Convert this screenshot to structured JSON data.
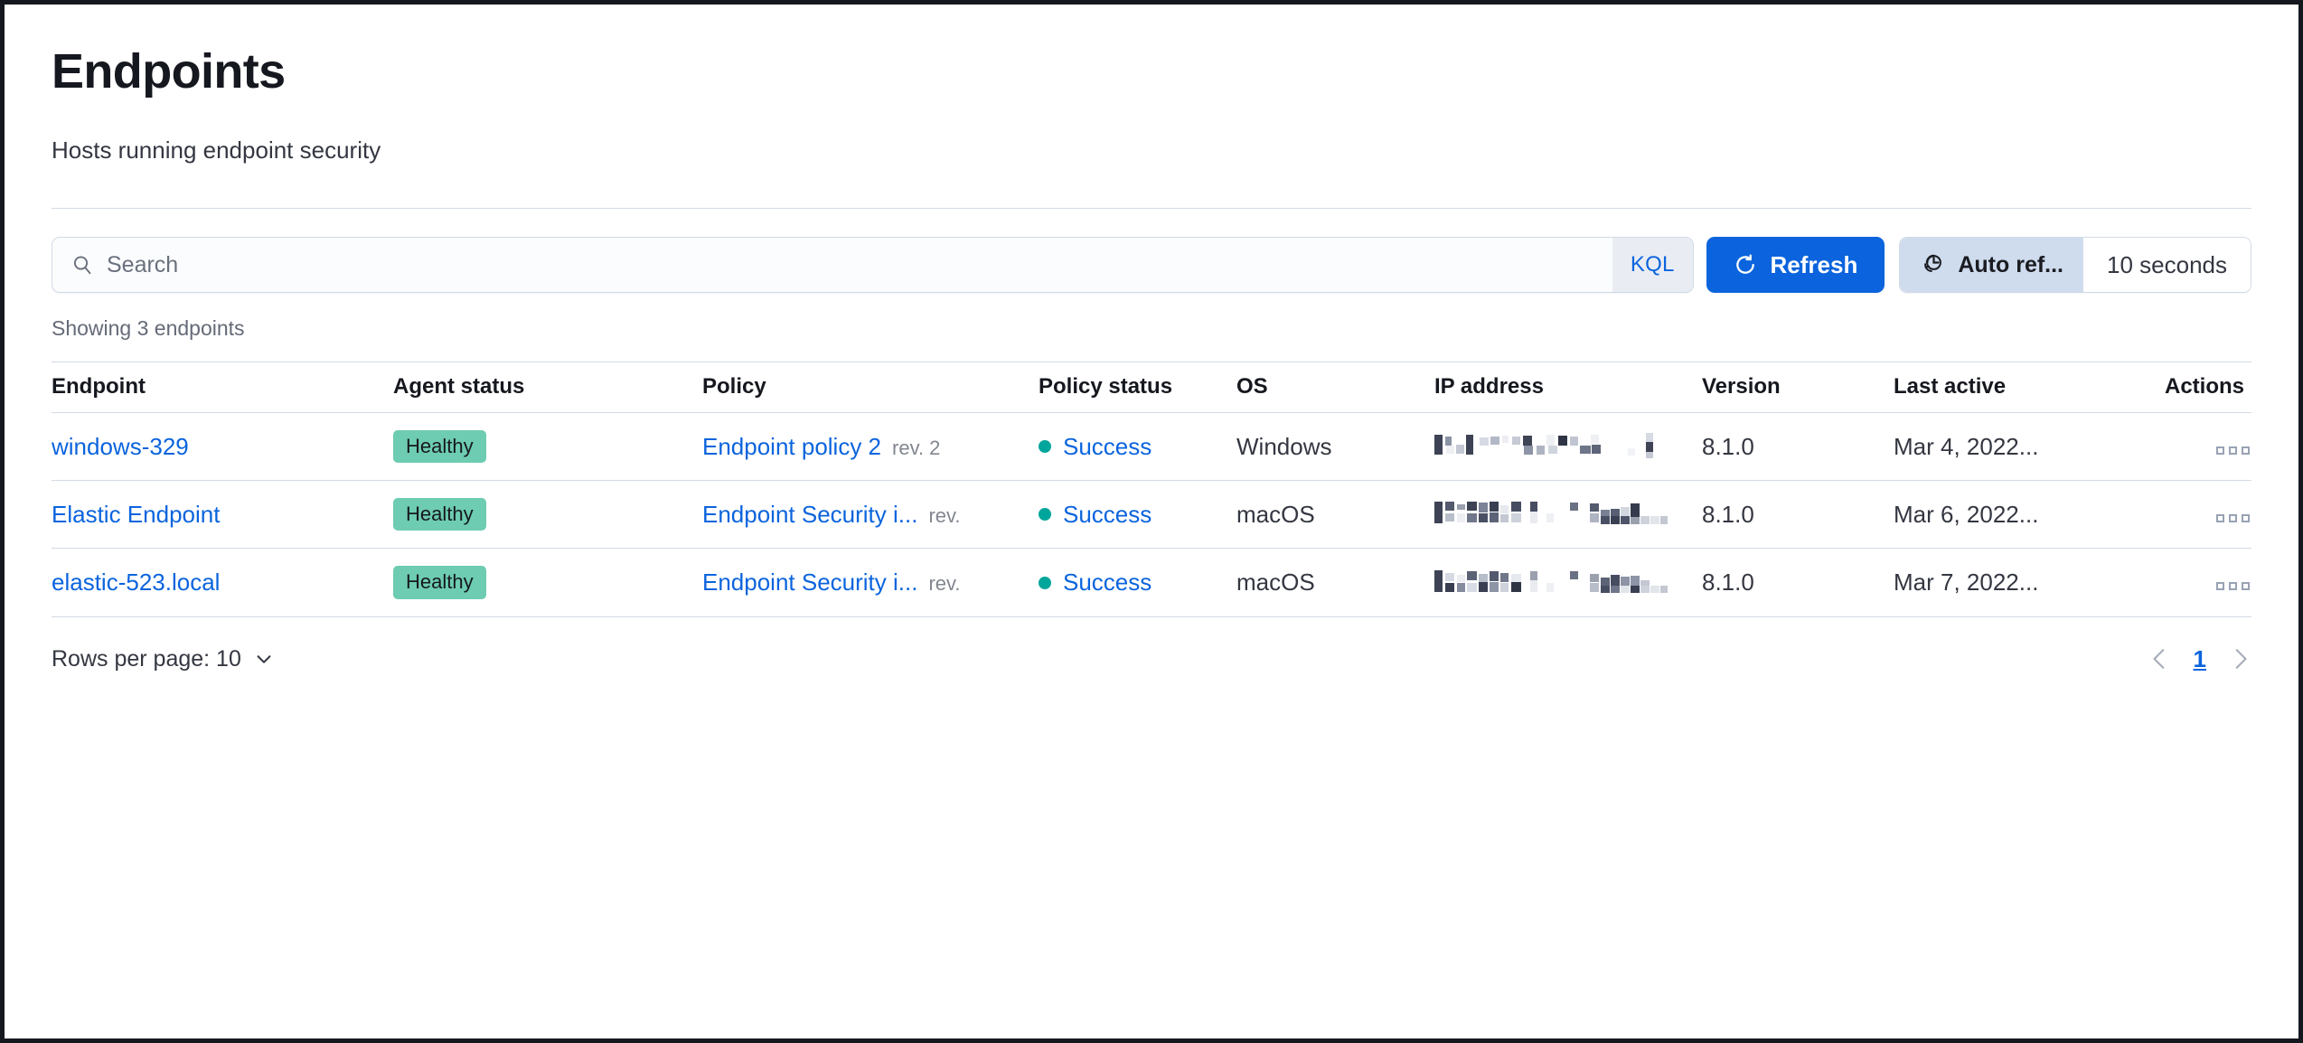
{
  "header": {
    "title": "Endpoints",
    "subtitle": "Hosts running endpoint security"
  },
  "search": {
    "value": "",
    "placeholder": "Search",
    "query_language_badge": "KQL",
    "search_icon": "search-icon"
  },
  "toolbar": {
    "refresh_label": "Refresh",
    "refresh_icon": "refresh-icon",
    "auto_refresh_label": "Auto ref...",
    "auto_refresh_icon": "clock-refresh-icon",
    "auto_refresh_interval": "10 seconds",
    "accent_color": "#0b64dd"
  },
  "table": {
    "showing_text": "Showing 3 endpoints",
    "columns": [
      "Endpoint",
      "Agent status",
      "Policy",
      "Policy status",
      "OS",
      "IP address",
      "Version",
      "Last active",
      "Actions"
    ],
    "rows": [
      {
        "endpoint": "windows-329",
        "agent_status": "Healthy",
        "policy_name": "Endpoint policy 2",
        "policy_rev": "rev. 2",
        "policy_status": "Success",
        "os": "Windows",
        "ip_address": "",
        "version": "8.1.0",
        "last_active": "Mar 4, 2022...",
        "actions_icon": "actions-boxes-icon"
      },
      {
        "endpoint": "Elastic Endpoint",
        "agent_status": "Healthy",
        "policy_name": "Endpoint Security i...",
        "policy_rev": "rev.",
        "policy_status": "Success",
        "os": "macOS",
        "ip_address": "",
        "version": "8.1.0",
        "last_active": "Mar 6, 2022...",
        "actions_icon": "actions-boxes-icon"
      },
      {
        "endpoint": "elastic-523.local",
        "agent_status": "Healthy",
        "policy_name": "Endpoint Security i...",
        "policy_rev": "rev.",
        "policy_status": "Success",
        "os": "macOS",
        "ip_address": "",
        "version": "8.1.0",
        "last_active": "Mar 7, 2022...",
        "actions_icon": "actions-boxes-icon"
      }
    ]
  },
  "footer": {
    "rows_per_page_label": "Rows per page: 10",
    "current_page": "1",
    "prev_icon": "chevron-left-icon",
    "next_icon": "chevron-right-icon"
  },
  "colors": {
    "link": "#0b64dd",
    "healthy_badge": "#6dccb1",
    "status_dot": "#00a69b",
    "border": "#d3dae6"
  }
}
